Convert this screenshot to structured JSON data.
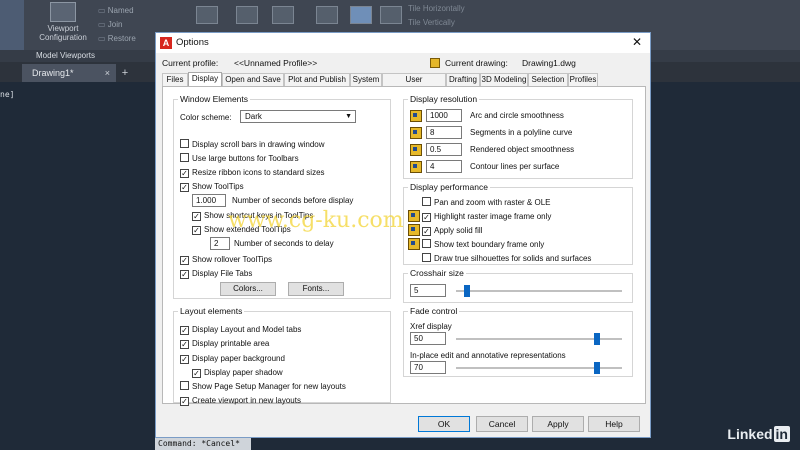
{
  "background": {
    "viewport_button": [
      "Viewport",
      "Configuration"
    ],
    "small_items": [
      "Named",
      "Join",
      "Restore"
    ],
    "tile_items": [
      "Tile Horizontally",
      "Tile Vertically"
    ],
    "panel_title": "Model Viewports",
    "file_tab": "Drawing1*",
    "left_edge_text": "ne]",
    "command_line": "Command: *Cancel*",
    "brand": [
      "Linked",
      "in"
    ]
  },
  "dialog": {
    "title": "Options",
    "current_profile_label": "Current profile:",
    "current_profile_value": "<<Unnamed Profile>>",
    "current_drawing_label": "Current drawing:",
    "current_drawing_value": "Drawing1.dwg",
    "tabs": [
      "Files",
      "Display",
      "Open and Save",
      "Plot and Publish",
      "System",
      "User Preferences",
      "Drafting",
      "3D Modeling",
      "Selection",
      "Profiles"
    ],
    "active_tab": "Display",
    "window_elements": {
      "legend": "Window Elements",
      "color_scheme_label": "Color scheme:",
      "color_scheme_value": "Dark",
      "display_scroll_bars": "Display scroll bars in drawing window",
      "large_buttons": "Use large buttons for Toolbars",
      "resize_ribbon": "Resize ribbon icons to standard sizes",
      "show_tooltips": "Show ToolTips",
      "seconds_before_display_value": "1.000",
      "seconds_before_display_label": "Number of seconds before display",
      "shortcut_keys": "Show shortcut keys in ToolTips",
      "extended_tooltips": "Show extended ToolTips",
      "seconds_to_delay_value": "2",
      "seconds_to_delay_label": "Number of seconds to delay",
      "rollover_tooltips": "Show rollover ToolTips",
      "file_tabs": "Display File Tabs",
      "colors_button": "Colors...",
      "fonts_button": "Fonts..."
    },
    "layout_elements": {
      "legend": "Layout elements",
      "layout_model_tabs": "Display Layout and Model tabs",
      "printable_area": "Display printable area",
      "paper_background": "Display paper background",
      "paper_shadow": "Display paper shadow",
      "page_setup_manager": "Show Page Setup Manager for new layouts",
      "create_viewport": "Create viewport in new layouts"
    },
    "display_resolution": {
      "legend": "Display resolution",
      "items": [
        {
          "value": "1000",
          "label": "Arc and circle smoothness"
        },
        {
          "value": "8",
          "label": "Segments in a polyline curve"
        },
        {
          "value": "0.5",
          "label": "Rendered object smoothness"
        },
        {
          "value": "4",
          "label": "Contour lines per surface"
        }
      ]
    },
    "display_performance": {
      "legend": "Display performance",
      "pan_zoom": "Pan and zoom with raster & OLE",
      "highlight_raster": "Highlight raster image frame only",
      "apply_solid_fill": "Apply solid fill",
      "text_boundary": "Show text boundary frame only",
      "true_silhouettes": "Draw true silhouettes for solids and surfaces"
    },
    "crosshair": {
      "legend": "Crosshair size",
      "value": "5",
      "level": 5
    },
    "fade_control": {
      "legend": "Fade control",
      "xref_label": "Xref display",
      "xref_value": "50",
      "xref_level": 0.5,
      "inplace_label": "In-place edit and annotative representations",
      "inplace_value": "70",
      "inplace_level": 0.5
    },
    "buttons": {
      "ok": "OK",
      "cancel": "Cancel",
      "apply": "Apply",
      "help": "Help"
    }
  },
  "watermark": "www.cg-ku.com",
  "colors": {
    "accent": "#0a66c2",
    "autocad_red": "#d7261e",
    "background": "#1f2a38"
  }
}
